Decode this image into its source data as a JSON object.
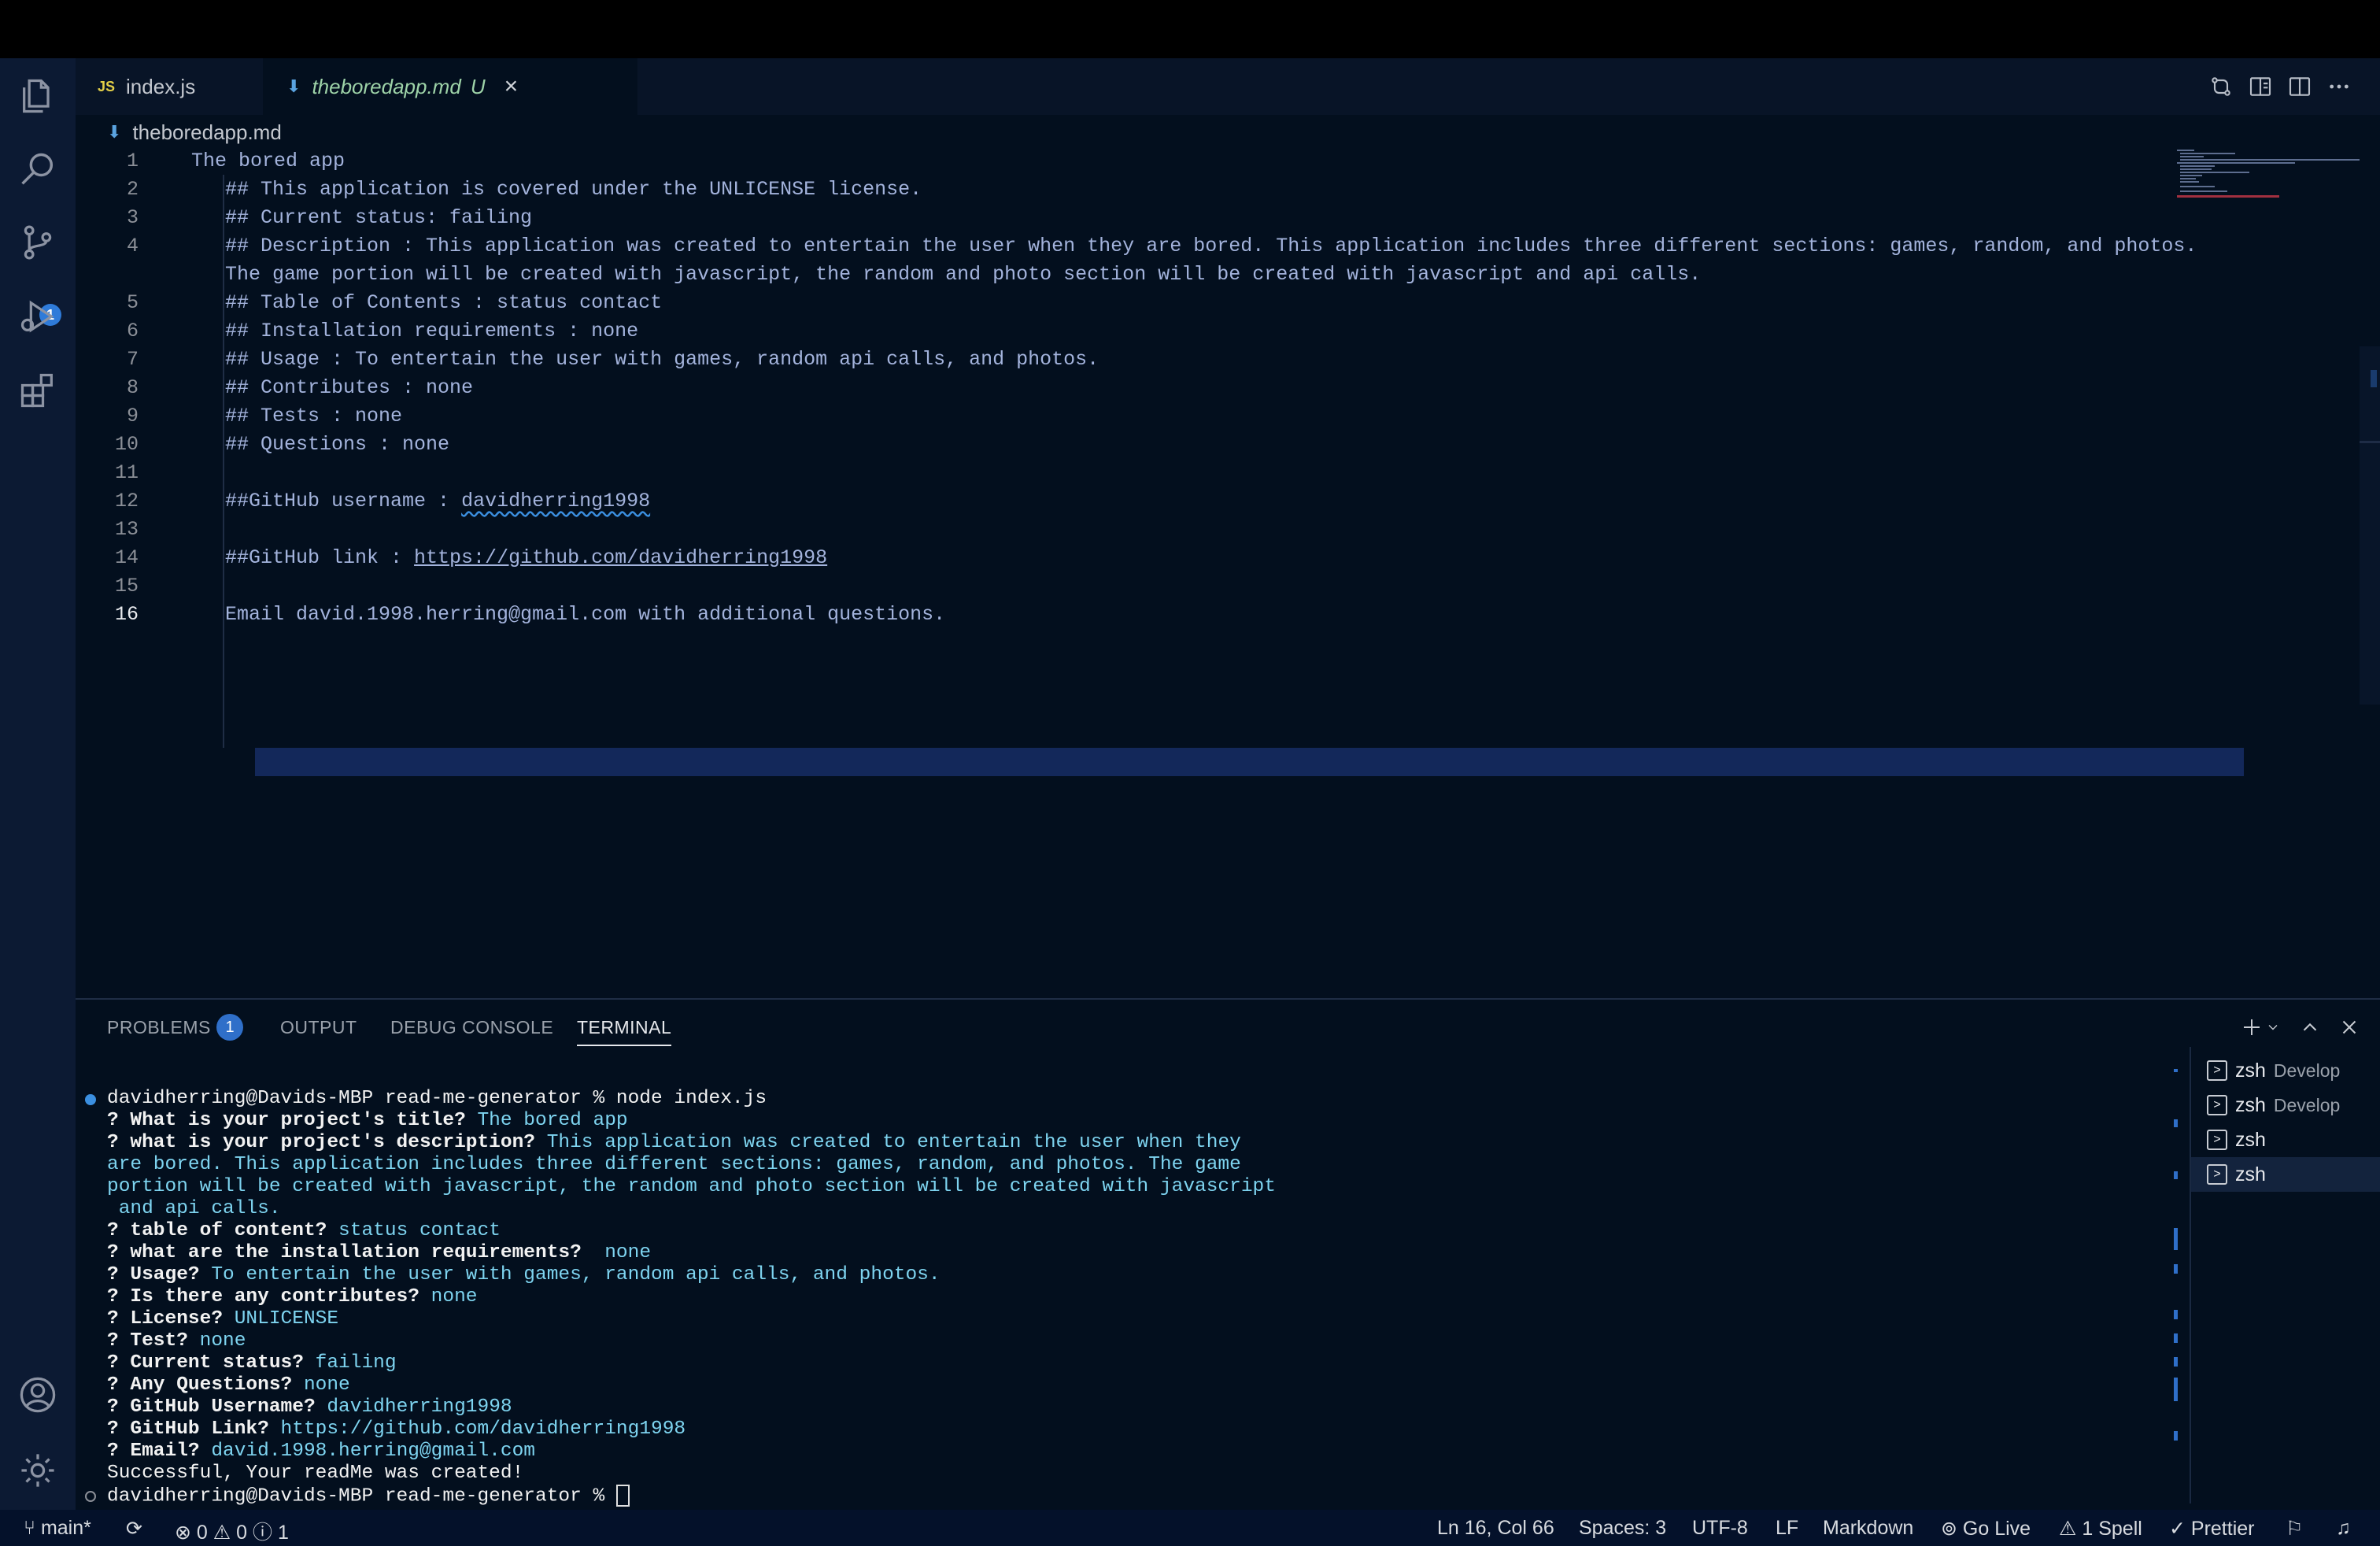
{
  "tabs": [
    {
      "label": "index.js",
      "icon": "JS"
    },
    {
      "label": "theboredapp.md",
      "status": "U"
    }
  ],
  "breadcrumb": "theboredapp.md",
  "editor": {
    "line_numbers": [
      "1",
      "2",
      "3",
      "4",
      "5",
      "6",
      "7",
      "8",
      "9",
      "10",
      "11",
      "12",
      "13",
      "14",
      "15",
      "16"
    ],
    "lines": [
      "The bored app",
      "## This application is covered under the UNLICENSE license.",
      "## Current status: failing",
      "## Description : This application was created to entertain the user when they are bored. This application includes three different sections: games, random, and photos.",
      "The game portion will be created with javascript, the random and photo section will be created with javascript and api calls.",
      "## Table of Contents : status contact",
      "## Installation requirements : none",
      "## Usage : To entertain the user with games, random api calls, and photos.",
      "## Contributes : none",
      "## Tests : none",
      "## Questions : none",
      "##GitHub username : ",
      "davidherring1998",
      "##GitHub link : ",
      "https://github.com/davidherring1998",
      "Email david.1998.herring@gmail.com with additional questions."
    ]
  },
  "panel": {
    "tabs": [
      "PROBLEMS",
      "OUTPUT",
      "DEBUG CONSOLE",
      "TERMINAL"
    ],
    "problems_count": "1",
    "terminals": [
      {
        "name": "zsh",
        "sub": "Develop"
      },
      {
        "name": "zsh",
        "sub": "Develop"
      },
      {
        "name": "zsh",
        "sub": ""
      },
      {
        "name": "zsh",
        "sub": ""
      }
    ],
    "terminal": {
      "prompt": "davidherring@Davids-MBP read-me-generator % ",
      "command": "node index.js",
      "qa": [
        {
          "q": "? What is your project's title?",
          "a": " The bored app"
        },
        {
          "q": "? what is your project's description?",
          "a": " This application was created to entertain the user when they"
        },
        {
          "q": "",
          "a": "are bored. This application includes three different sections: games, random, and photos. The game"
        },
        {
          "q": "",
          "a": "portion will be created with javascript, the random and photo section will be created with javascript"
        },
        {
          "q": "",
          "a": " and api calls."
        },
        {
          "q": "? table of content?",
          "a": " status contact"
        },
        {
          "q": "? what are the installation requirements?",
          "a": "  none"
        },
        {
          "q": "? Usage?",
          "a": " To entertain the user with games, random api calls, and photos."
        },
        {
          "q": "? Is there any contributes?",
          "a": " none"
        },
        {
          "q": "? License?",
          "a": " UNLICENSE"
        },
        {
          "q": "? Test?",
          "a": " none"
        },
        {
          "q": "? Current status?",
          "a": " failing"
        },
        {
          "q": "? Any Questions?",
          "a": " none"
        },
        {
          "q": "? GitHub Username?",
          "a": " davidherring1998"
        },
        {
          "q": "? GitHub Link?",
          "a": " https://github.com/davidherring1998"
        },
        {
          "q": "? Email?",
          "a": " david.1998.herring@gmail.com"
        }
      ],
      "result": "Successful, Your readMe was created!",
      "prompt2": "davidherring@Davids-MBP read-me-generator % "
    }
  },
  "activity": {
    "source_control_badge": "1"
  },
  "status": {
    "branch": "main*",
    "errors": "0",
    "warnings": "0",
    "info": "1",
    "position": "Ln 16, Col 66",
    "spaces": "Spaces: 3",
    "encoding": "UTF-8",
    "eol": "LF",
    "language": "Markdown",
    "golive": "Go Live",
    "spell": "1 Spell",
    "prettier": "Prettier"
  },
  "colors": {
    "accent": "#2f7bd9",
    "code_text": "#a3b3dc",
    "answer": "#7ed4f0",
    "background": "#030f1e"
  }
}
